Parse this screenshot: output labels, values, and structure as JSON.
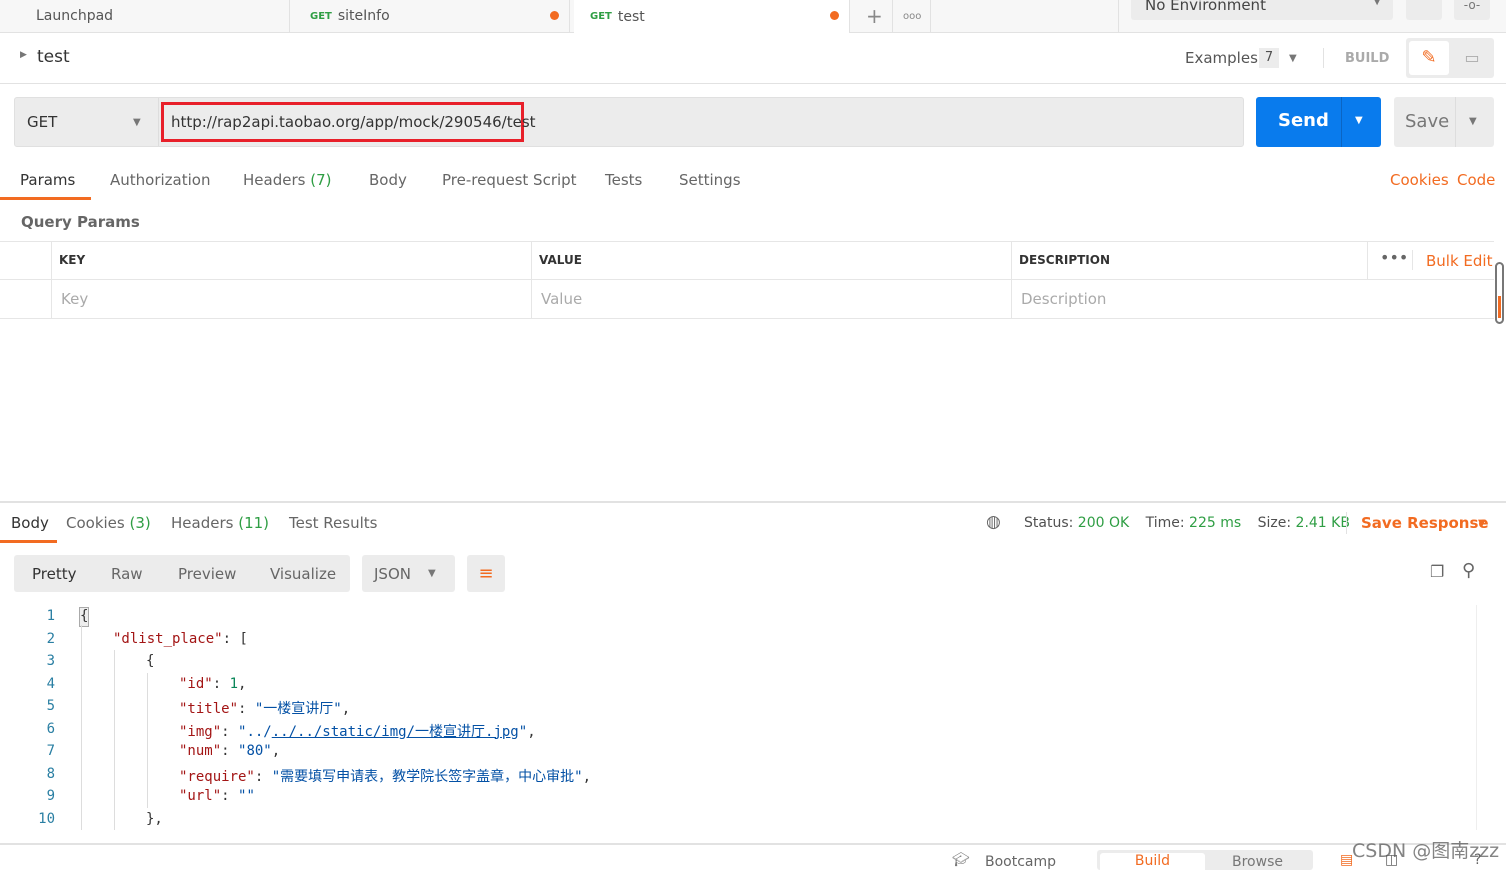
{
  "tabs": [
    {
      "label": "Launchpad"
    },
    {
      "method": "GET",
      "label": "siteInfo",
      "unsaved": true
    },
    {
      "method": "GET",
      "label": "test",
      "unsaved": true,
      "active": true
    }
  ],
  "environment": "No Environment",
  "request": {
    "name": "test",
    "examples_label": "Examples",
    "examples_count": "7",
    "build_label": "BUILD",
    "method": "GET",
    "url": "http://rap2api.taobao.org/app/mock/290546/test",
    "send": "Send",
    "save": "Save"
  },
  "req_tabs": [
    {
      "label": "Params",
      "active": true
    },
    {
      "label": "Authorization"
    },
    {
      "label": "Headers",
      "count": "(7)"
    },
    {
      "label": "Body"
    },
    {
      "label": "Pre-request Script"
    },
    {
      "label": "Tests"
    },
    {
      "label": "Settings"
    }
  ],
  "req_links": {
    "cookies": "Cookies",
    "code": "Code"
  },
  "params": {
    "title": "Query Params",
    "headers": [
      "KEY",
      "VALUE",
      "DESCRIPTION"
    ],
    "bulk_edit": "Bulk Edit",
    "placeholders": [
      "Key",
      "Value",
      "Description"
    ]
  },
  "response": {
    "tabs": [
      {
        "label": "Body",
        "active": true
      },
      {
        "label": "Cookies",
        "count": "(3)"
      },
      {
        "label": "Headers",
        "count": "(11)"
      },
      {
        "label": "Test Results"
      }
    ],
    "status_label": "Status:",
    "status": "200 OK",
    "time_label": "Time:",
    "time": "225 ms",
    "size_label": "Size:",
    "size": "2.41 KB",
    "save_response": "Save Response",
    "views": [
      "Pretty",
      "Raw",
      "Preview",
      "Visualize"
    ],
    "format": "JSON",
    "lines": [
      [
        [
          "p",
          "{"
        ]
      ],
      [
        [
          "k",
          "\"dlist_place\""
        ],
        [
          "p",
          ": ["
        ]
      ],
      [
        [
          "p",
          "{"
        ]
      ],
      [
        [
          "k",
          "\"id\""
        ],
        [
          "p",
          ": "
        ],
        [
          "n",
          "1"
        ],
        [
          "p",
          ","
        ]
      ],
      [
        [
          "k",
          "\"title\""
        ],
        [
          "p",
          ": "
        ],
        [
          "s",
          "\"一楼宣讲厅\""
        ],
        [
          "p",
          ","
        ]
      ],
      [
        [
          "k",
          "\"img\""
        ],
        [
          "p",
          ": "
        ],
        [
          "s",
          "\"../"
        ],
        [
          "s link",
          "../../static/img/一楼宣讲厅.jpg"
        ],
        [
          "s",
          "\""
        ],
        [
          "p",
          ","
        ]
      ],
      [
        [
          "k",
          "\"num\""
        ],
        [
          "p",
          ": "
        ],
        [
          "s",
          "\"80\""
        ],
        [
          "p",
          ","
        ]
      ],
      [
        [
          "k",
          "\"require\""
        ],
        [
          "p",
          ": "
        ],
        [
          "s",
          "\"需要填写申请表，教学院长签字盖章，中心审批\""
        ],
        [
          "p",
          ","
        ]
      ],
      [
        [
          "k",
          "\"url\""
        ],
        [
          "p",
          ": "
        ],
        [
          "s",
          "\"\""
        ]
      ],
      [
        [
          "p",
          "},"
        ]
      ]
    ],
    "indents": [
      0,
      1,
      2,
      3,
      3,
      3,
      3,
      3,
      3,
      2
    ]
  },
  "footer": {
    "bootcamp": "Bootcamp",
    "build": "Build",
    "browse": "Browse"
  },
  "watermark": "CSDN @图南zzz",
  "colors": {
    "accent": "#f26b21",
    "send": "#097bed",
    "ok": "#2f9e44"
  }
}
